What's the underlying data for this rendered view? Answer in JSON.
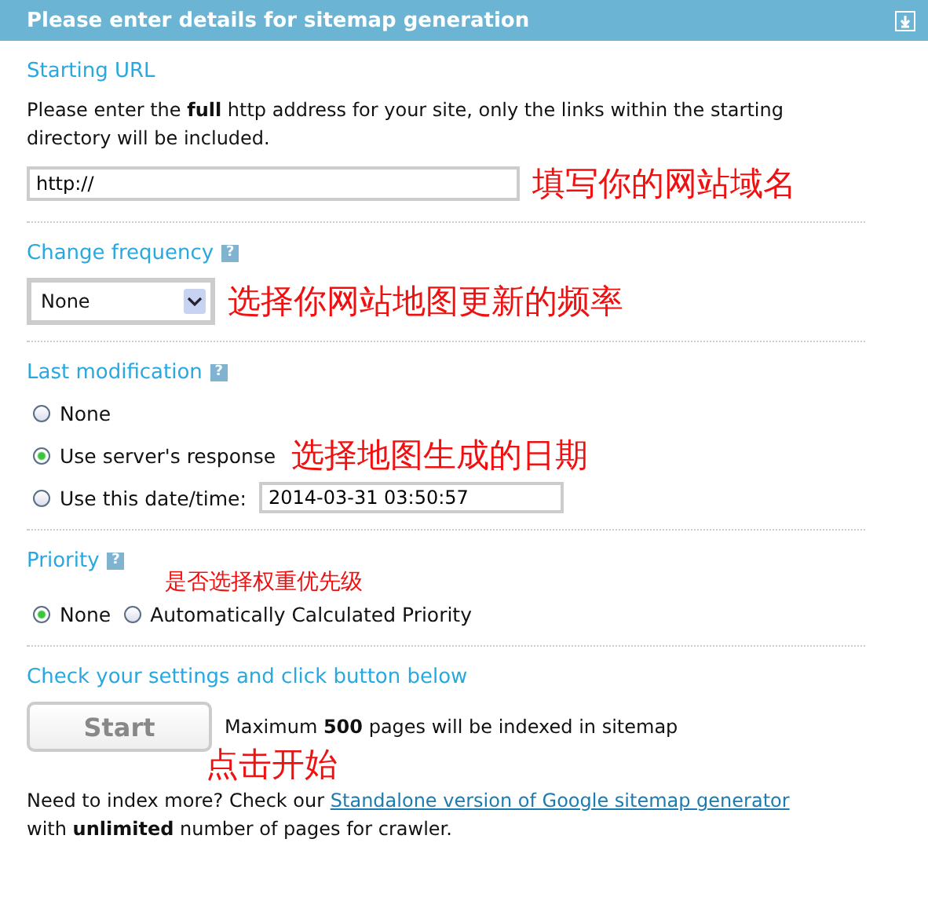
{
  "header": {
    "title": "Please enter details for sitemap generation"
  },
  "starting_url": {
    "heading": "Starting URL",
    "description": "Please enter the **full** http address for your site, only the links within the starting directory will be included.",
    "field_value": "http://",
    "annotation": "填写你的网站域名"
  },
  "change_frequency": {
    "heading": "Change frequency",
    "help": "?",
    "select_value": "None",
    "annotation": "选择你网站地图更新的频率"
  },
  "last_modification": {
    "heading": "Last modification",
    "help": "?",
    "annotation": "选择地图生成的日期",
    "options": [
      {
        "kind": "plain",
        "label": "None",
        "selected": false
      },
      {
        "kind": "plain",
        "label": "Use server's response",
        "selected": true
      },
      {
        "kind": "datetime",
        "label": "Use this date/time:",
        "selected": false,
        "value": "2014-03-31 03:50:57"
      }
    ]
  },
  "priority": {
    "heading": "Priority",
    "help": "?",
    "annotation": "是否选择权重优先级",
    "options": [
      {
        "label": "None",
        "selected": true
      },
      {
        "label": "Automatically Calculated Priority",
        "selected": false
      }
    ]
  },
  "submit": {
    "heading": "Check your settings and click button below",
    "button": "Start",
    "note": "Maximum **500** pages will be indexed in sitemap",
    "annotation": "点击开始",
    "more_text": "Need to index more? Check our",
    "link": "Standalone version of Google sitemap generator",
    "more_text_end": "with **unlimited** number of pages for crawler."
  }
}
